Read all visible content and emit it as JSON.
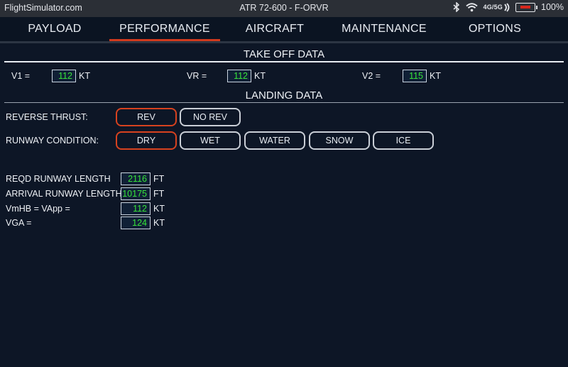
{
  "status_bar": {
    "site": "FlightSimulator.com",
    "aircraft": "ATR 72-600 - F-ORVR",
    "network": "4G/5G",
    "battery": "100%"
  },
  "tabs": [
    {
      "label": "PAYLOAD",
      "active": false
    },
    {
      "label": "PERFORMANCE",
      "active": true
    },
    {
      "label": "AIRCRAFT",
      "active": false
    },
    {
      "label": "MAINTENANCE",
      "active": false
    },
    {
      "label": "OPTIONS",
      "active": false
    }
  ],
  "takeoff": {
    "title": "TAKE OFF DATA",
    "v1": {
      "label": "V1 =",
      "value": "112",
      "unit": "KT"
    },
    "vr": {
      "label": "VR =",
      "value": "112",
      "unit": "KT"
    },
    "v2": {
      "label": "V2 =",
      "value": "115",
      "unit": "KT"
    }
  },
  "landing": {
    "title": "LANDING DATA",
    "reverse_thrust": {
      "label": "REVERSE THRUST:",
      "options": [
        "REV",
        "NO REV"
      ],
      "selected": "REV"
    },
    "runway_condition": {
      "label": "RUNWAY CONDITION:",
      "options": [
        "DRY",
        "WET",
        "WATER",
        "SNOW",
        "ICE"
      ],
      "selected": "DRY"
    },
    "results": [
      {
        "label": "REQD RUNWAY LENGTH",
        "value": "2116",
        "unit": "FT"
      },
      {
        "label": "ARRIVAL RUNWAY LENGTH",
        "value": "10175",
        "unit": "FT"
      },
      {
        "label": "VmHB = VApp =",
        "value": "112",
        "unit": "KT"
      },
      {
        "label": "VGA =",
        "value": "124",
        "unit": "KT"
      }
    ]
  },
  "colors": {
    "background": "#0d1626",
    "accent": "#d13a1d",
    "value_text": "#37e33a"
  }
}
